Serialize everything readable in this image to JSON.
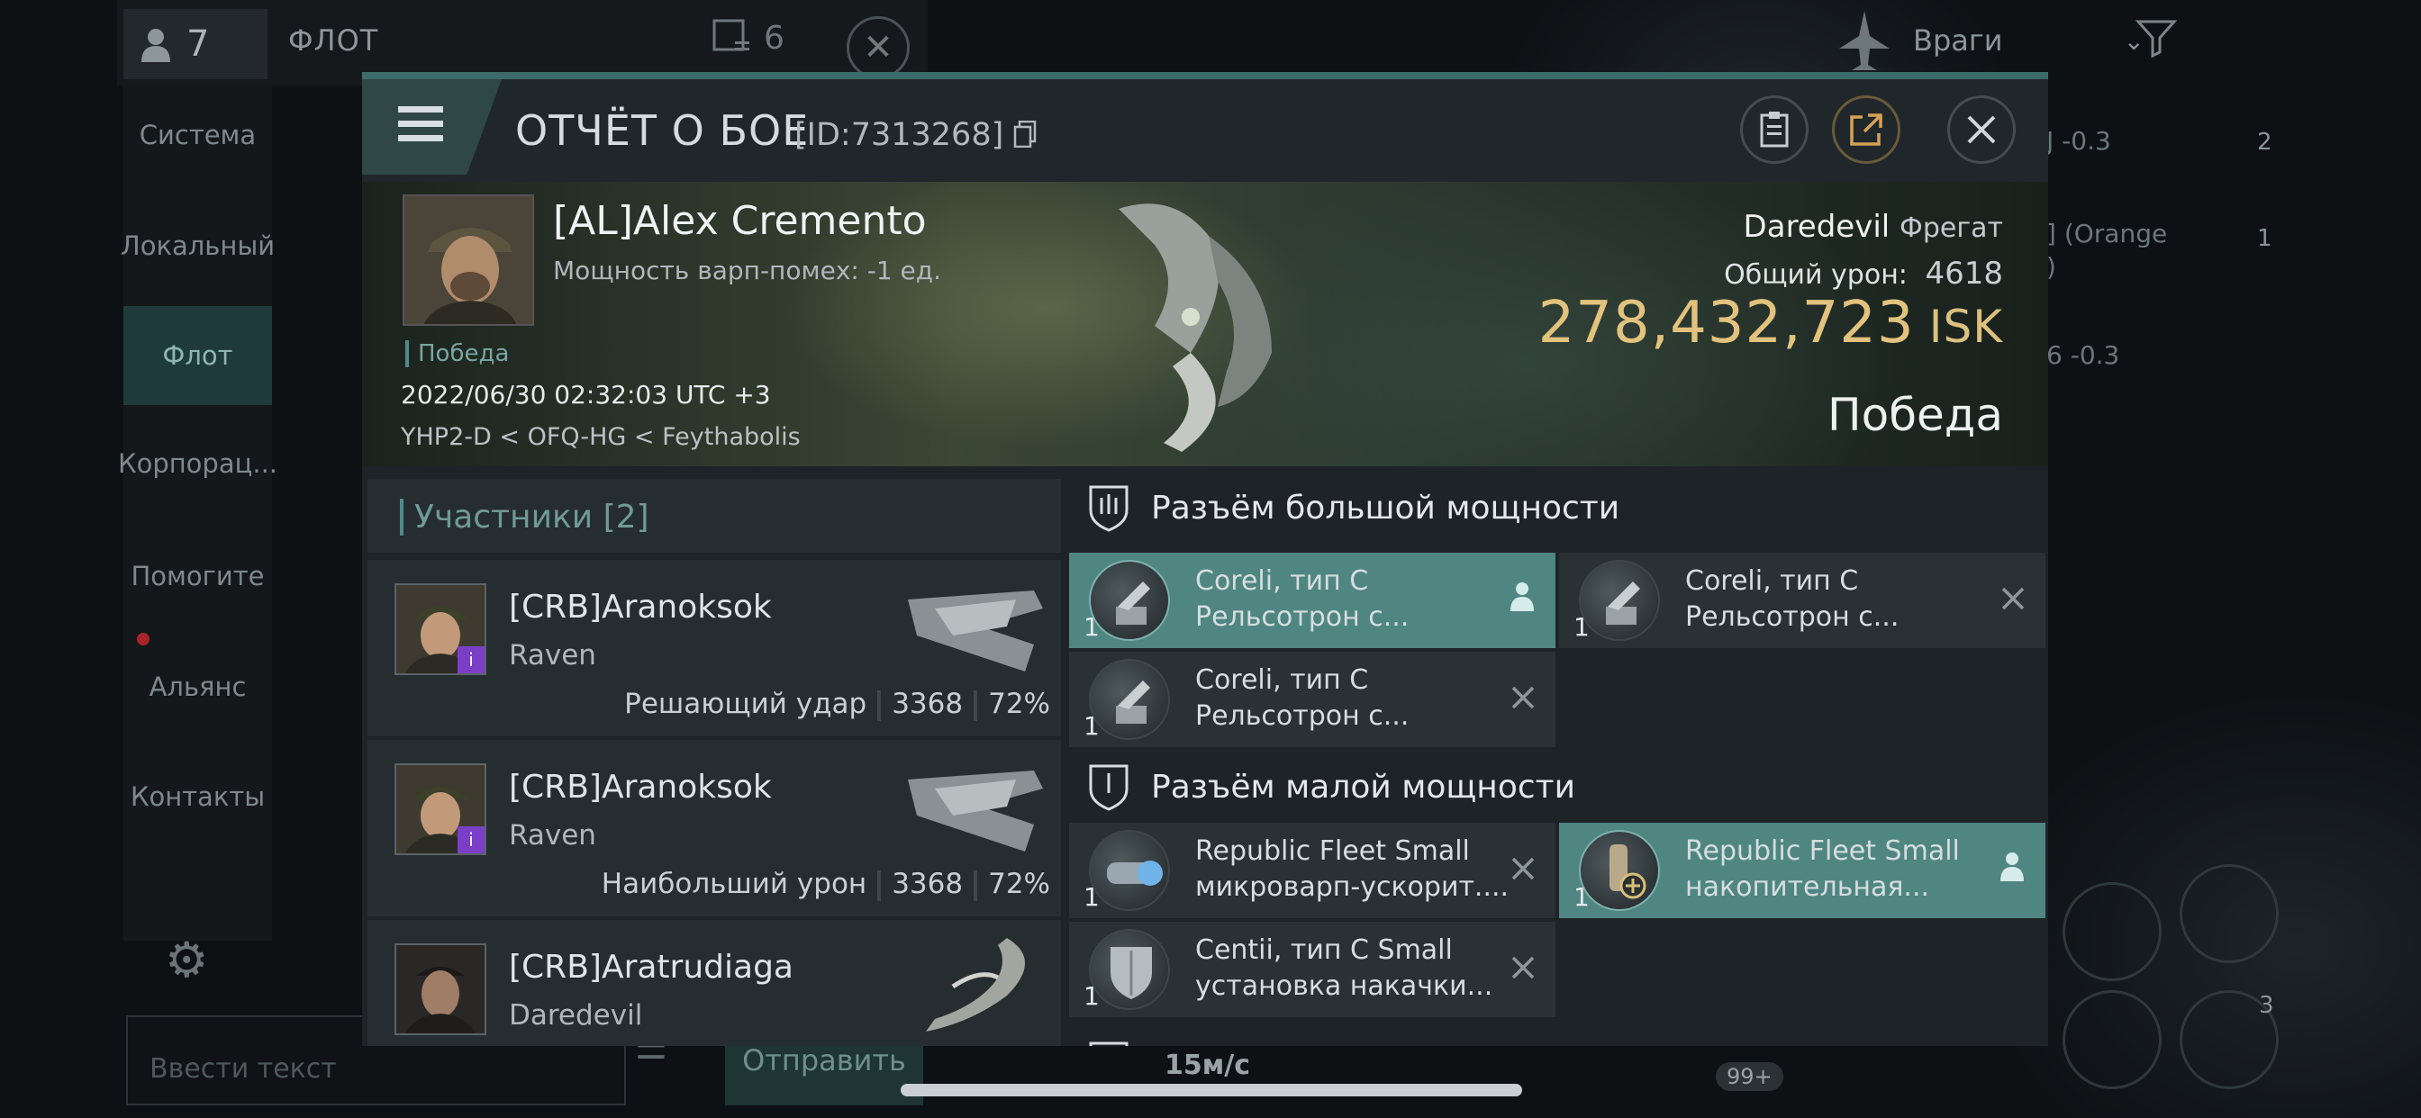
{
  "background": {
    "people_count": "7",
    "fleet_title": "ФЛОТ",
    "fleet_count": "6",
    "enemy_filter": "Враги",
    "sidebar": [
      {
        "label": "Система",
        "active": false
      },
      {
        "label": "Локальный",
        "active": false
      },
      {
        "label": "Флот",
        "active": true
      },
      {
        "label": "Корпорац...",
        "active": false
      },
      {
        "label": "Помогите",
        "active": false
      },
      {
        "label": "Альянс",
        "active": false
      },
      {
        "label": "Контакты",
        "active": false
      }
    ],
    "chat_placeholder": "Ввести текст",
    "send_label": "Отправить",
    "speed": "15м/с",
    "right_labels": [
      "J -0.3",
      "] (Orange",
      ")",
      "6 -0.3"
    ],
    "right_counts": [
      "2",
      "1"
    ],
    "badge_99": "99+",
    "badge_3": "3"
  },
  "dialog": {
    "title": "ОТЧЁТ О БОЕ",
    "report_id": "[ID:7313268]",
    "pilot": {
      "name": "[AL]Alex Cremento",
      "warp_disruption": "Мощность варп-помех: -1 ед.",
      "result_tag": "Победа",
      "datetime": "2022/06/30 02:32:03 UTC +3",
      "location": "YHP2-D < OFQ-HG < Feythabolis"
    },
    "ship": {
      "name": "Daredevil",
      "class": "Фрегат",
      "total_damage_label": "Общий урон:",
      "total_damage": "4618",
      "isk_value": "278,432,723",
      "isk_currency": "ISK",
      "result": "Победа"
    },
    "participants": {
      "title": "Участники",
      "count": "[2]",
      "rows": [
        {
          "name": "[CRB]Aranoksok",
          "ship": "Raven",
          "role": "Решающий удар",
          "damage": "3368",
          "percent": "72%"
        },
        {
          "name": "[CRB]Aranoksok",
          "ship": "Raven",
          "role": "Наибольший урон",
          "damage": "3368",
          "percent": "72%"
        },
        {
          "name": "[CRB]Aratrudiaga",
          "ship": "Daredevil",
          "role": "",
          "damage": "",
          "percent": ""
        }
      ]
    },
    "high_slots": {
      "title": "Разъём большой мощности",
      "modules": [
        {
          "qty": "1",
          "line1": "Coreli, тип C",
          "line2": "Рельсотрон с...",
          "action": "person-icon",
          "highlighted": true
        },
        {
          "qty": "1",
          "line1": "Coreli, тип C",
          "line2": "Рельсотрон с...",
          "action": "close-icon",
          "highlighted": false
        },
        {
          "qty": "1",
          "line1": "Coreli, тип C",
          "line2": "Рельсотрон с...",
          "action": "close-icon",
          "highlighted": false
        }
      ]
    },
    "low_slots": {
      "title": "Разъём малой мощности",
      "modules": [
        {
          "qty": "1",
          "line1": "Republic Fleet Small",
          "line2": "микроварп-ускорит....",
          "action": "close-icon",
          "highlighted": false
        },
        {
          "qty": "1",
          "line1": "Republic Fleet Small",
          "line2": "накопительная...",
          "action": "person-icon",
          "highlighted": true
        },
        {
          "qty": "1",
          "line1": "Centii, тип C Small",
          "line2": "установка накачки...",
          "action": "close-icon",
          "highlighted": false
        }
      ]
    }
  },
  "colors": {
    "accent_teal": "#4f8682",
    "isk_gold": "#e2c27d",
    "dialog_bg": "#1d2327"
  }
}
